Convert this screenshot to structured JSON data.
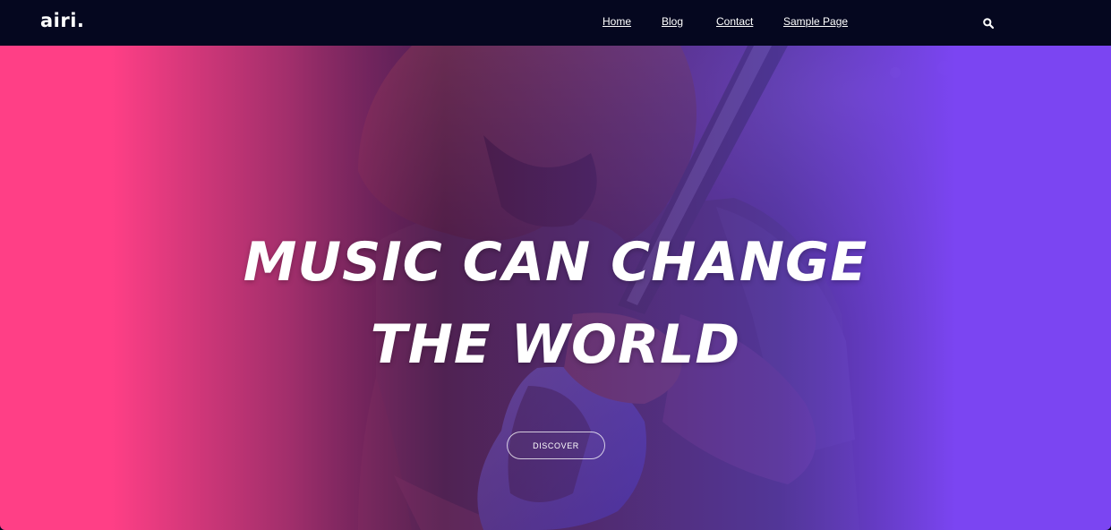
{
  "header": {
    "logo": "airi.",
    "nav": [
      {
        "label": "Home"
      },
      {
        "label": "Blog"
      },
      {
        "label": "Contact"
      },
      {
        "label": "Sample Page"
      }
    ],
    "search_icon": "search-icon"
  },
  "hero": {
    "headline_line1": "MUSIC CAN CHANGE",
    "headline_line2": "THE WORLD",
    "button_label": "DISCOVER",
    "image": "guitarist-performing-photo",
    "gradient": {
      "left": "#ff3f86",
      "mid": "#8a3bbd",
      "right": "#7b45f2"
    }
  },
  "colors": {
    "header_bg": "#05071f",
    "text": "#ffffff"
  }
}
